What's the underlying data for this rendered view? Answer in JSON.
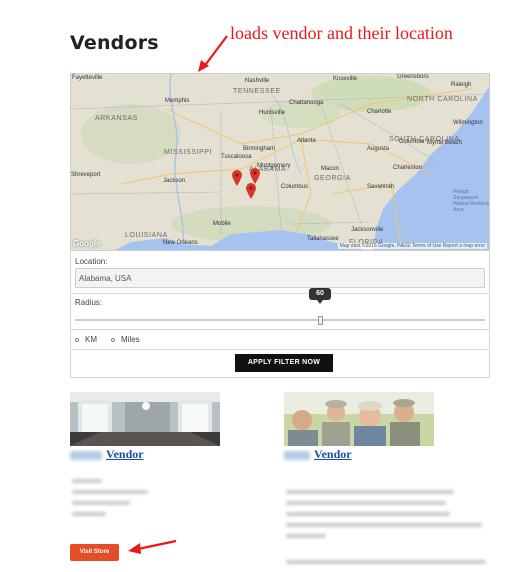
{
  "page": {
    "title": "Vendors"
  },
  "annotations": {
    "map_note": "loads vendor and their location"
  },
  "map": {
    "cities": [
      "Fayetteville",
      "Memphis",
      "Nashville",
      "Knoxville",
      "Greensboro",
      "Raleigh",
      "Charlotte",
      "Chattanooga",
      "Huntsville",
      "Atlanta",
      "Birmingham",
      "Columbia",
      "Jackson",
      "Tuscaloosa",
      "Montgomery",
      "Columbus",
      "Macon",
      "Augusta",
      "Savannah",
      "Charleston",
      "Shreveport",
      "Mobile",
      "Jacksonville",
      "New Orleans",
      "Tallahassee",
      "Wilmington",
      "Myrtle Beach"
    ],
    "states": [
      "ARKANSAS",
      "TENNESSEE",
      "NORTH CAROLINA",
      "SOUTH CAROLINA",
      "MISSISSIPPI",
      "ALABAMA",
      "GEORGIA",
      "LOUISIANA",
      "FLORIDA"
    ],
    "sea_label": "Pelagic Sargassum Habitat Restricted Area",
    "attribution": "Map data ©2016 Google, INEGI   Terms of Use   Report a map error",
    "logo": "Google",
    "marker_count": 3
  },
  "filter": {
    "location_label": "Location:",
    "location_value": "Alabama, USA",
    "radius_label": "Radius:",
    "radius_value": "60",
    "radius_fraction": 0.6,
    "units": [
      "KM",
      "Miles"
    ],
    "apply_label": "APPLY FILTER NOW"
  },
  "vendors": [
    {
      "name": "Vendor",
      "image": "empty-room-photo"
    },
    {
      "name": "Vendor",
      "image": "group-of-men-photo"
    }
  ],
  "visit_button": "Visit Store",
  "colors": {
    "accent": "#e24e26",
    "annotation": "#e8191a",
    "link": "#1a4fa0",
    "button_dark": "#111111"
  }
}
